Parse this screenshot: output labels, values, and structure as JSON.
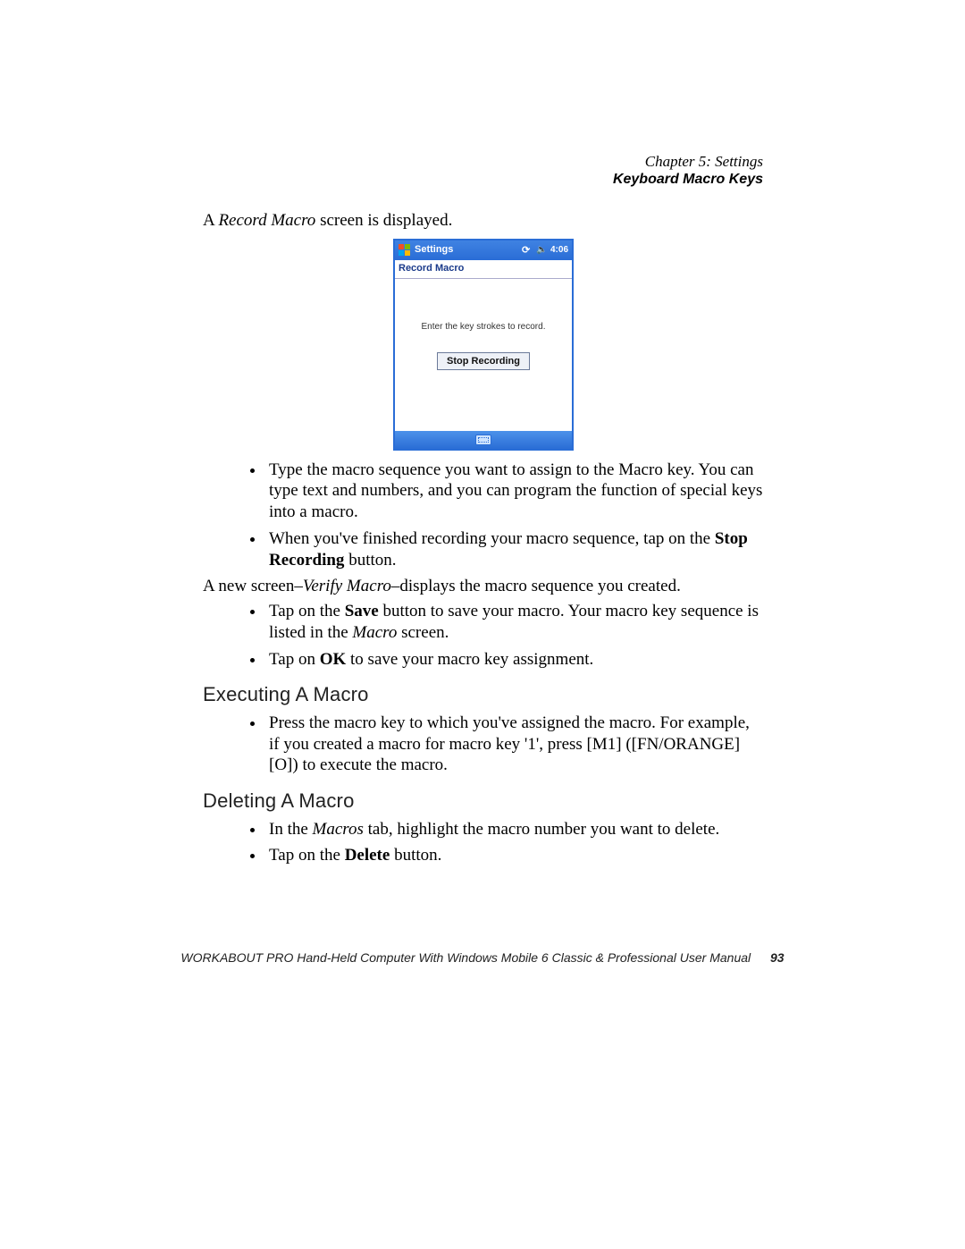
{
  "header": {
    "chapter": "Chapter 5: Settings",
    "section": "Keyboard Macro Keys"
  },
  "intro": {
    "prefix": "A ",
    "ital": "Record Macro",
    "suffix": " screen is displayed."
  },
  "screenshot": {
    "title": "Settings",
    "time": "4:06",
    "tab": "Record Macro",
    "prompt": "Enter the key strokes to record.",
    "button": "Stop Recording"
  },
  "bullets1": [
    "Type the macro sequence you want to assign to the Macro key. You can type text and numbers, and you can program the function of special keys into a macro."
  ],
  "bullet1b": {
    "prefix": "When you've finished recording your macro sequence, tap on the ",
    "bold": "Stop Recording",
    "suffix": " button."
  },
  "verify": {
    "prefix": "A new screen–",
    "ital": "Verify Macro",
    "suffix": "–displays the macro sequence you created."
  },
  "bullets2a": {
    "prefix": "Tap on the ",
    "bold": "Save",
    "mid": " button to save your macro. Your macro key sequence is listed in the ",
    "ital": "Macro",
    "suffix": " screen."
  },
  "bullets2b": {
    "prefix": "Tap on ",
    "bold": "OK",
    "suffix": " to save your macro key assignment."
  },
  "h_exec": "Executing A Macro",
  "exec_bullet": "Press the macro key to which you've assigned the macro. For example, if you created a macro for macro key '1', press [M1] ([FN/ORANGE][O]) to execute the macro.",
  "h_del": "Deleting A Macro",
  "del_b1": {
    "prefix": "In the ",
    "ital": "Macros",
    "mid": " tab, highlight the macro number you want to delete."
  },
  "del_b2": {
    "prefix": "Tap on the ",
    "bold": "Delete",
    "suffix": " button."
  },
  "footer": {
    "text": "WORKABOUT PRO Hand-Held Computer With Windows Mobile 6 Classic & Professional User Manual",
    "page": "93"
  }
}
